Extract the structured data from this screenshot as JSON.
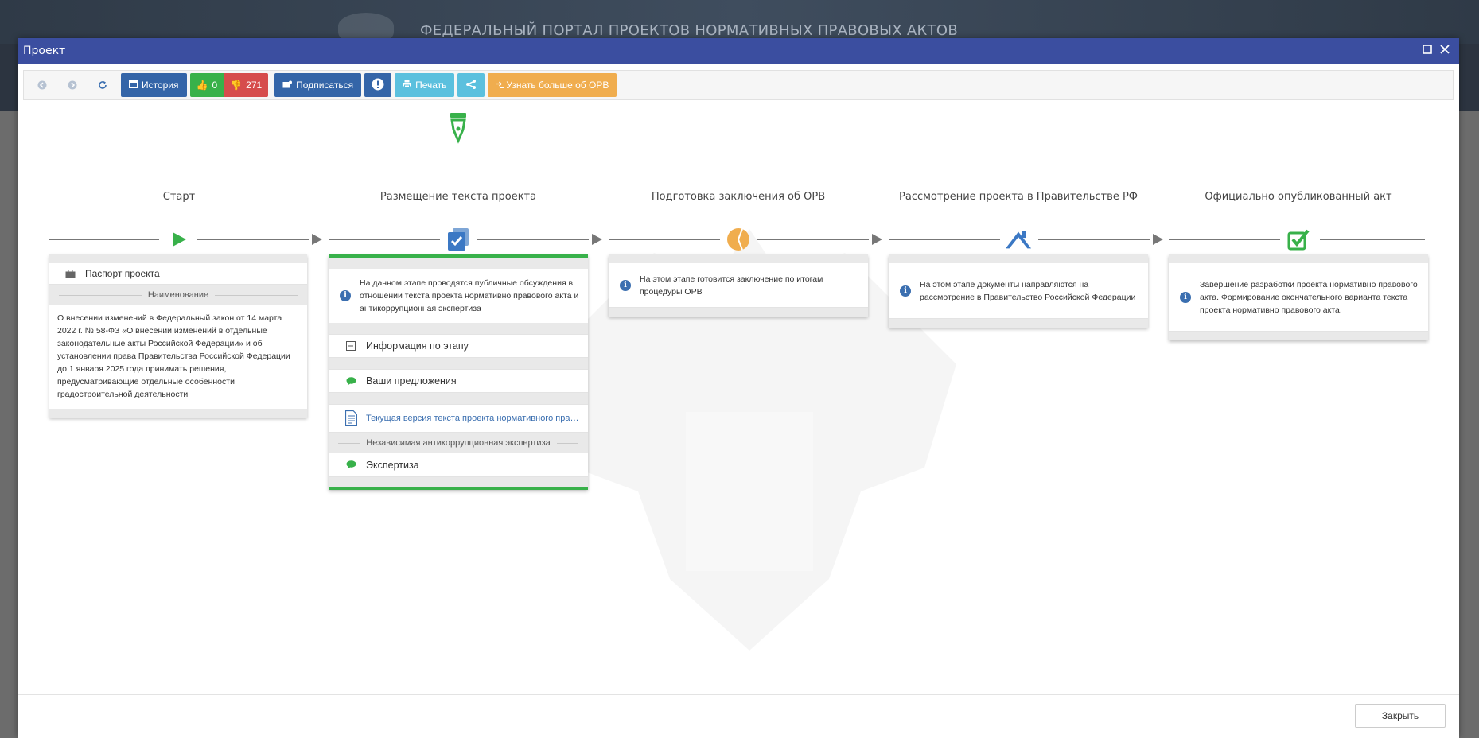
{
  "background": {
    "portal_title": "ФЕДЕРАЛЬНЫЙ ПОРТАЛ ПРОЕКТОВ НОРМАТИВНЫХ ПРАВОВЫХ АКТОВ"
  },
  "modal": {
    "title": "Проект",
    "maximize_icon": "maximize-icon",
    "close_icon": "close-icon"
  },
  "toolbar": {
    "history_label": "История",
    "likes_count": "0",
    "dislikes_count": "271",
    "subscribe_label": "Подписаться",
    "print_label": "Печать",
    "learn_more_label": "Узнать больше об ОРВ"
  },
  "colors": {
    "header": "#3b4ea0",
    "blue": "#3465a8",
    "green": "#38b14a",
    "red": "#d64c4c",
    "light_blue": "#5bc0de",
    "orange": "#f0ad4e"
  },
  "stages": [
    {
      "title": "Старт",
      "icon": "play-icon"
    },
    {
      "title": "Размещение текста проекта",
      "icon": "checked-document-icon"
    },
    {
      "title": "Подготовка заключения об ОРВ",
      "icon": "pie-chart-icon"
    },
    {
      "title": "Рассмотрение проекта в Правительстве РФ",
      "icon": "roof-icon"
    },
    {
      "title": "Официально опубликованный акт",
      "icon": "checkbox-icon"
    }
  ],
  "passport": {
    "label": "Паспорт проекта",
    "name_header": "Наименование",
    "name_text": "О внесении изменений в Федеральный закон от 14 марта 2022 г. № 58-ФЗ «О внесении изменений в отдельные законодательные акты Российской Федерации» и об установлении права Правительства Российской Федерации до 1 января 2025 года принимать решения, предусматривающие отдельные особенности градостроительной деятельности"
  },
  "stage2": {
    "info": "На данном этапе проводятся публичные обсуждения в отношении текста проекта нормативно правового акта и антикоррупционная экспертиза",
    "stage_info_label": "Информация по этапу",
    "suggestions_label": "Ваши предложения",
    "current_version_link": "Текущая версия текста проекта нормативного правового акта",
    "anticorruption_header": "Независимая антикоррупционная экспертиза",
    "expertise_label": "Экспертиза"
  },
  "stage3": {
    "info": "На этом этапе готовится заключение по итогам процедуры ОРВ"
  },
  "stage4": {
    "info": "На этом этапе документы направляются на рассмотрение в Правительство Российской Федерации"
  },
  "stage5": {
    "info": "Завершение разработки проекта нормативно правового акта. Формирование окончательного варианта текста проекта нормативно правового акта."
  },
  "footer": {
    "close_label": "Закрыть"
  }
}
